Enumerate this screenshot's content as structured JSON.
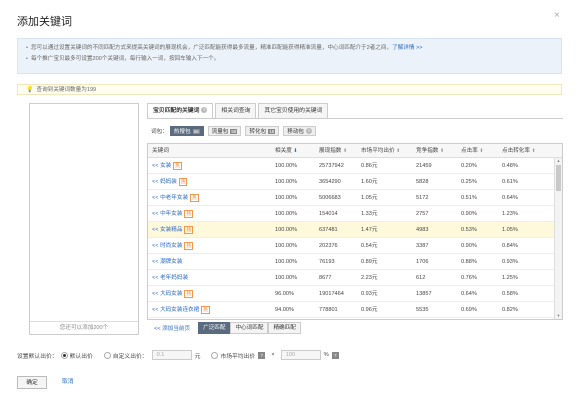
{
  "dialog": {
    "title": "添加关键词",
    "close": "×",
    "info_line1": "您可以通过设置关键词的不同匹配方式来提高关键词的展现机会，广泛匹配能获得最多流量，精准匹配能获得精准流量，中心词匹配介于2者之间，",
    "info_link": "了解详情 >>",
    "info_line2": "每个推广宝贝最多可设置200个关键词，每行输入一词，按回车输入下一个。",
    "warn": "查询到关键词数量为199"
  },
  "left_panel": {
    "footer": "您还可以添加200个"
  },
  "tabs": [
    {
      "label": "宝贝匹配的关键词",
      "help": "?"
    },
    {
      "label": "相关词查询"
    },
    {
      "label": "其它宝贝使用的关键词"
    }
  ],
  "filters": {
    "label": "词包：",
    "items": [
      {
        "label": "热搜包",
        "count": "56"
      },
      {
        "label": "流量包",
        "count": "58"
      },
      {
        "label": "转化包",
        "count": "19"
      },
      {
        "label": "移动包",
        "q": "?"
      }
    ]
  },
  "table": {
    "headers": [
      "关键词",
      "相关度",
      "展现指数",
      "市场平均出价",
      "竞争指数",
      "点击率",
      "点击转化率"
    ],
    "rows": [
      {
        "kw": "<< 女装",
        "badge": "热",
        "rel": "100.00%",
        "imp": "25737942",
        "bid": "0.86元",
        "comp": "21459",
        "ctr": "0.20%",
        "cvr": "0.48%"
      },
      {
        "kw": "<< 妈妈装",
        "badge": "热",
        "rel": "100.00%",
        "imp": "3654290",
        "bid": "1.60元",
        "comp": "5828",
        "ctr": "0.25%",
        "cvr": "0.61%"
      },
      {
        "kw": "<< 中老年女装",
        "badge": "热",
        "rel": "100.00%",
        "imp": "5006683",
        "bid": "1.05元",
        "comp": "5172",
        "ctr": "0.51%",
        "cvr": "0.64%"
      },
      {
        "kw": "<< 中年女装",
        "badge": "热",
        "rel": "100.00%",
        "imp": "154014",
        "bid": "1.33元",
        "comp": "2757",
        "ctr": "0.90%",
        "cvr": "1.23%"
      },
      {
        "kw": "<< 女装精品",
        "badge": "热",
        "rel": "100.00%",
        "imp": "637481",
        "bid": "1.47元",
        "comp": "4983",
        "ctr": "0.53%",
        "cvr": "1.05%",
        "highlight": true
      },
      {
        "kw": "<< 时尚女装",
        "badge": "热",
        "rel": "100.00%",
        "imp": "202376",
        "bid": "0.54元",
        "comp": "3387",
        "ctr": "0.90%",
        "cvr": "0.84%"
      },
      {
        "kw": "<< 潮牌女装",
        "badge": "",
        "rel": "100.00%",
        "imp": "76193",
        "bid": "0.89元",
        "comp": "1706",
        "ctr": "0.88%",
        "cvr": "0.93%"
      },
      {
        "kw": "<< 老年妈妈装",
        "badge": "",
        "rel": "100.00%",
        "imp": "8677",
        "bid": "2.23元",
        "comp": "612",
        "ctr": "0.76%",
        "cvr": "1.25%"
      },
      {
        "kw": "<< 大码女装",
        "badge": "热",
        "rel": "96.00%",
        "imp": "19017464",
        "bid": "0.93元",
        "comp": "13857",
        "ctr": "0.64%",
        "cvr": "0.58%"
      },
      {
        "kw": "<< 大码女装连衣裙",
        "badge": "热",
        "rel": "94.00%",
        "imp": "778801",
        "bid": "0.96元",
        "comp": "5535",
        "ctr": "0.69%",
        "cvr": "0.82%"
      }
    ]
  },
  "bottom": {
    "add_all": "<< 添加当前页",
    "match_tabs": [
      "广泛匹配",
      "中心词匹配",
      "精确匹配"
    ]
  },
  "settings": {
    "label": "设置默认出价：",
    "opt_default": "默认出价",
    "opt_custom": "自定义出价：",
    "custom_value": "0.1",
    "custom_unit": "元",
    "opt_market": "市场平均出价",
    "times": "×",
    "market_value": "100",
    "market_unit": "%"
  },
  "buttons": {
    "ok": "确定",
    "cancel": "取消"
  },
  "colors": {
    "accent": "#2b6ac7",
    "badge": "#f07020",
    "active_chip": "#5a6b7f",
    "highlight_row": "#fff9db"
  }
}
